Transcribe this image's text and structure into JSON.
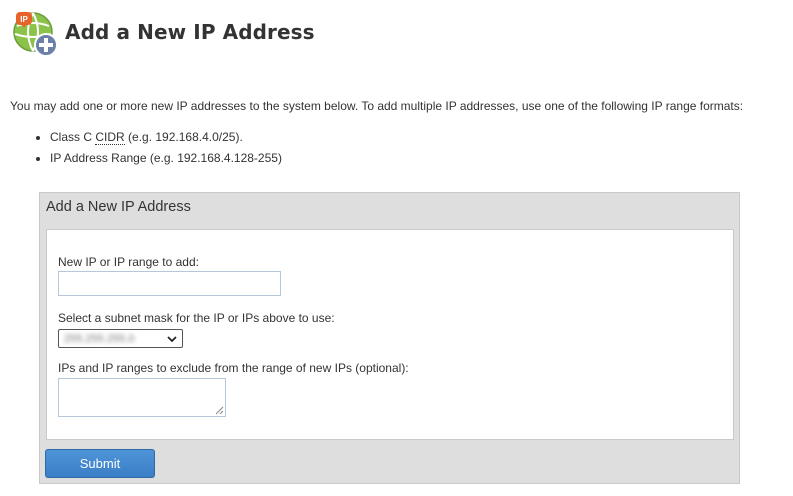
{
  "header": {
    "title": "Add a New IP Address",
    "icon": "ip-add-icon",
    "icon_badge_text": "IP"
  },
  "intro": {
    "text": "You may add one or more new IP addresses to the system below. To add multiple IP addresses, use one of the following IP range formats:",
    "formats": [
      {
        "prefix": "Class C ",
        "abbr": "CIDR",
        "suffix": " (e.g. 192.168.4.0/25)."
      },
      {
        "text": "IP Address Range (e.g. 192.168.4.128-255)"
      }
    ]
  },
  "form": {
    "panel_title": "Add a New IP Address",
    "ip_label": "New IP or IP range to add:",
    "ip_value": "",
    "subnet_label": "Select a subnet mask for the IP or IPs above to use:",
    "subnet_value": "255.255.255.0",
    "exclude_label": "IPs and IP ranges to exclude from the range of new IPs (optional):",
    "exclude_value": "",
    "submit_label": "Submit"
  },
  "colors": {
    "accent": "#4a90d9",
    "panel_bg": "#dedede",
    "icon_green": "#7cb342",
    "icon_orange": "#e8632a",
    "icon_plus": "#6b7fa8"
  }
}
